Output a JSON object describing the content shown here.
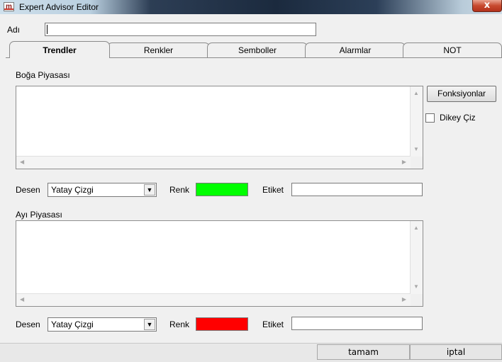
{
  "window": {
    "title": "Expert Advisor Editor",
    "app_icon_glyph": "m",
    "close_glyph": "x"
  },
  "name_row": {
    "label": "Adı",
    "value": ""
  },
  "tabs": [
    {
      "label": "Trendler",
      "active": true
    },
    {
      "label": "Renkler",
      "active": false
    },
    {
      "label": "Semboller",
      "active": false
    },
    {
      "label": "Alarmlar",
      "active": false
    },
    {
      "label": "NOT",
      "active": false
    }
  ],
  "bull": {
    "section_label": "Boğa Piyasası",
    "text": "",
    "pattern_label": "Desen",
    "pattern_value": "Yatay Çizgi",
    "color_label": "Renk",
    "color": "#00ff00",
    "tag_label": "Etiket",
    "tag_value": ""
  },
  "bear": {
    "section_label": "Ayı Piyasası",
    "text": "",
    "pattern_label": "Desen",
    "pattern_value": "Yatay Çizgi",
    "color_label": "Renk",
    "color": "#ff0000",
    "tag_label": "Etiket",
    "tag_value": ""
  },
  "side": {
    "functions_button": "Fonksiyonlar",
    "vertical_checkbox_label": "Dikey Çiz",
    "vertical_checked": false
  },
  "footer": {
    "ok_label": "tamam",
    "cancel_label": "iptal"
  }
}
